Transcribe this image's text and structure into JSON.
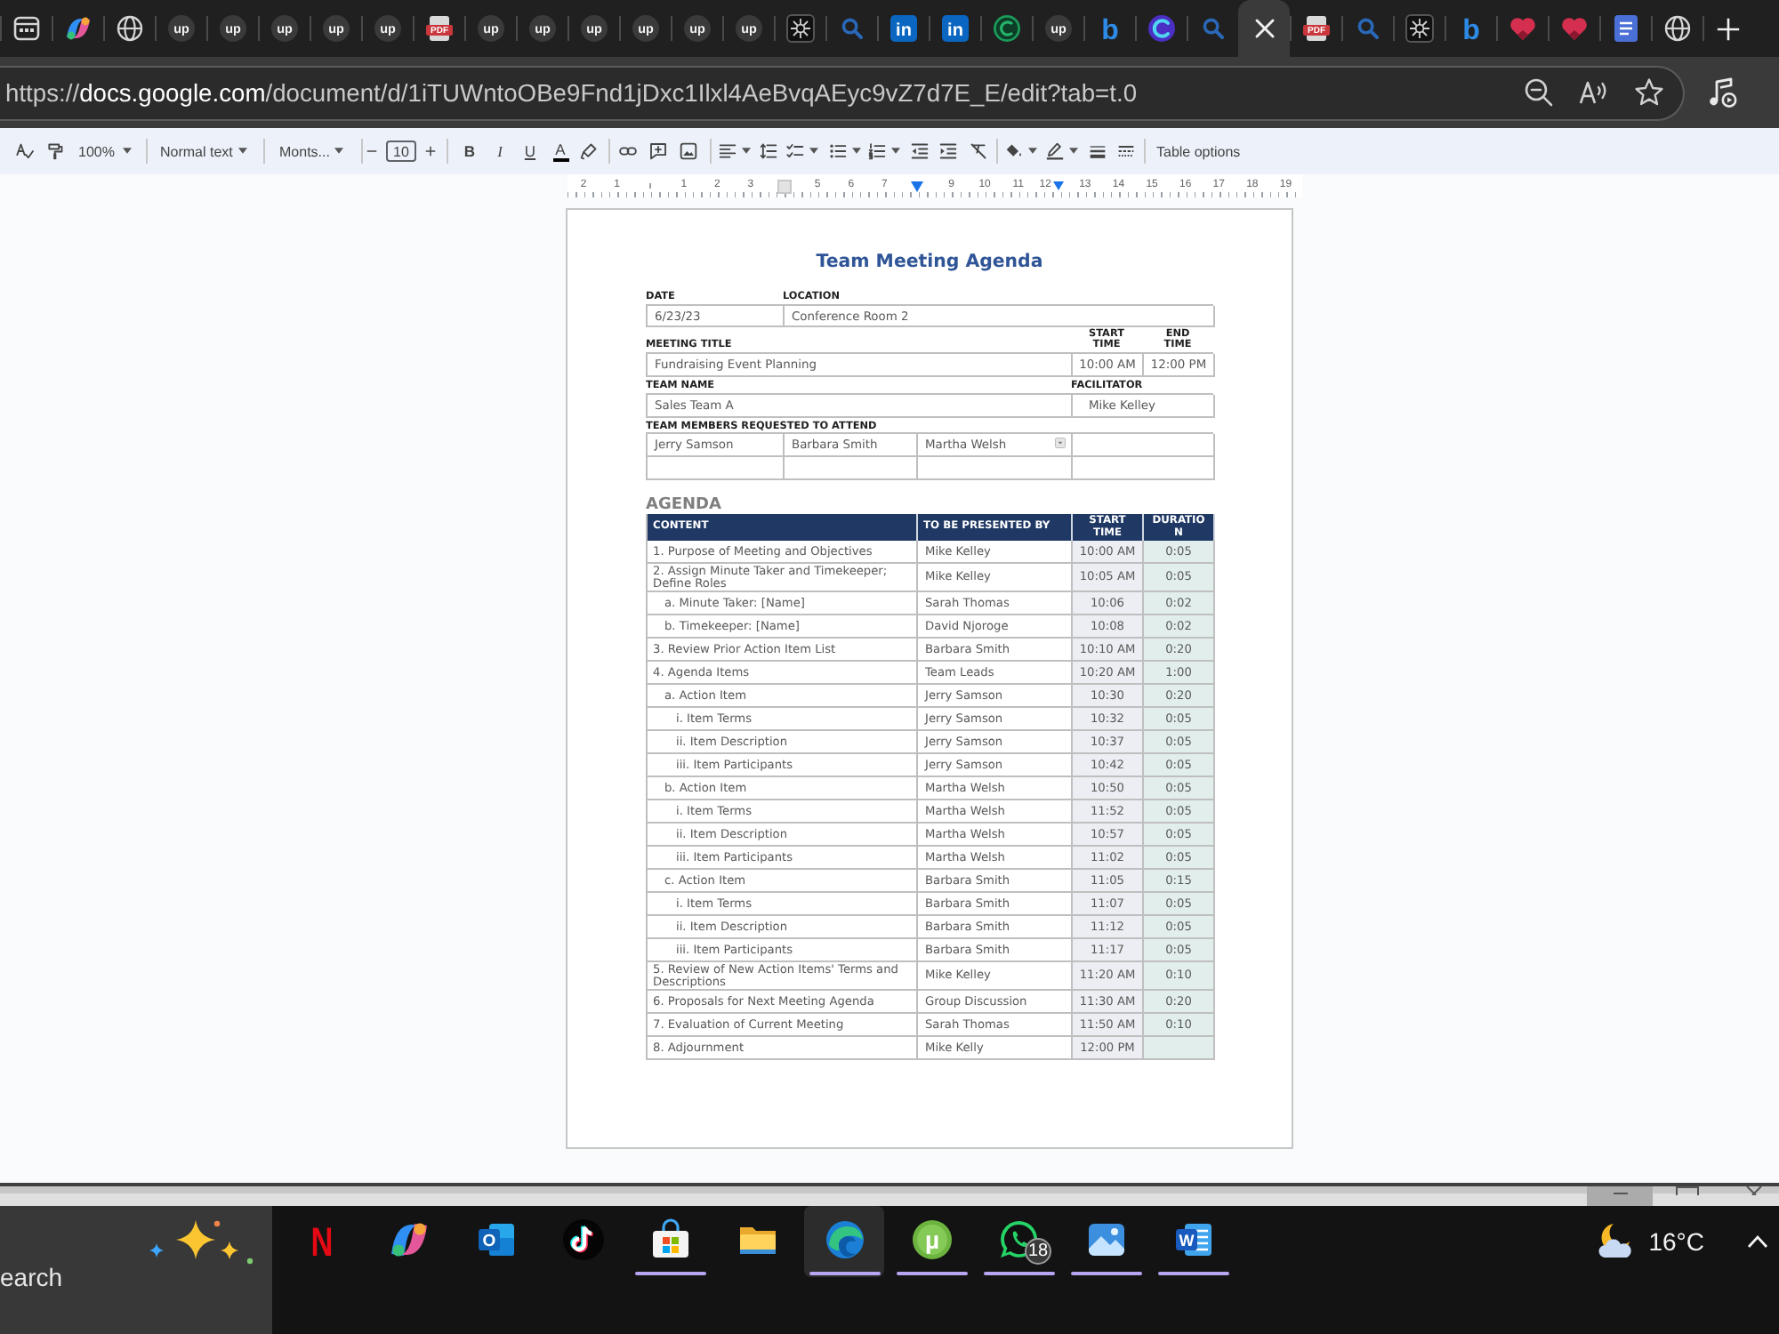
{
  "tabs": [
    {
      "kind": "window",
      "selected": false
    },
    {
      "kind": "swirl",
      "selected": false
    },
    {
      "kind": "globe",
      "selected": false
    },
    {
      "kind": "badge",
      "glyph": "up",
      "selected": false
    },
    {
      "kind": "badge",
      "glyph": "up",
      "selected": false
    },
    {
      "kind": "badge",
      "glyph": "up",
      "selected": false
    },
    {
      "kind": "badge",
      "glyph": "up",
      "selected": false
    },
    {
      "kind": "badge",
      "glyph": "up",
      "selected": false
    },
    {
      "kind": "file",
      "glyph": "PDF",
      "selected": false
    },
    {
      "kind": "badge",
      "glyph": "up",
      "selected": false
    },
    {
      "kind": "badge",
      "glyph": "up",
      "selected": false
    },
    {
      "kind": "badge",
      "glyph": "up",
      "selected": false
    },
    {
      "kind": "badge",
      "glyph": "up",
      "selected": false
    },
    {
      "kind": "badge",
      "glyph": "up",
      "selected": false
    },
    {
      "kind": "badge",
      "glyph": "up",
      "selected": false
    },
    {
      "kind": "spiky",
      "selected": false
    },
    {
      "kind": "search",
      "selected": false
    },
    {
      "kind": "tile",
      "glyph": "in",
      "selected": false
    },
    {
      "kind": "tile",
      "glyph": "in",
      "selected": false
    },
    {
      "kind": "ring",
      "selected": false
    },
    {
      "kind": "badge",
      "glyph": "up",
      "selected": false
    },
    {
      "kind": "letter",
      "glyph": "b",
      "selected": false
    },
    {
      "kind": "orb",
      "selected": false
    },
    {
      "kind": "search",
      "selected": false
    },
    {
      "selected": true
    },
    {
      "kind": "file",
      "glyph": "PDF",
      "selected": false
    },
    {
      "kind": "search",
      "selected": false
    },
    {
      "kind": "spiky",
      "selected": false
    },
    {
      "kind": "letter",
      "glyph": "b",
      "selected": false
    },
    {
      "kind": "heart",
      "selected": false
    },
    {
      "kind": "heart",
      "selected": false
    },
    {
      "kind": "doc",
      "selected": false
    },
    {
      "kind": "globe",
      "selected": false
    }
  ],
  "address_bar": {
    "url": "https://**docs.google.com**/document/d/1iTUWntoOBe9Fnd1jDxc1Ilxl4AeBvqAEyc9vZ7d7E_E/edit?tab=t.0"
  },
  "toolbar": {
    "zoom": "100%",
    "style": "Normal text",
    "font": "Monts...",
    "font_size": "10",
    "format_buttons": [
      {
        "kind": "bold",
        "label": "B"
      },
      {
        "kind": "italic",
        "label": "I"
      },
      {
        "kind": "underline",
        "label": "U"
      }
    ],
    "text_color": "A",
    "table_options": "Table options"
  },
  "ruler": [
    {
      "kind": "number",
      "text": "2",
      "marker": false
    },
    {
      "kind": "number",
      "text": "1",
      "marker": false
    },
    {
      "kind": "tick"
    },
    {
      "kind": "number",
      "text": "1",
      "marker": false
    },
    {
      "kind": "number",
      "text": "2",
      "marker": false
    },
    {
      "kind": "number",
      "text": "3",
      "marker": false
    },
    {
      "kind": "square"
    },
    {
      "kind": "number",
      "text": "5",
      "marker": false
    },
    {
      "kind": "number",
      "text": "6",
      "marker": false
    },
    {
      "kind": "number",
      "text": "7",
      "marker": false
    },
    {
      "kind": "indent"
    },
    {
      "kind": "number",
      "text": "9",
      "marker": false
    },
    {
      "kind": "number",
      "text": "10",
      "marker": false
    },
    {
      "kind": "number",
      "text": "11",
      "marker": false
    },
    {
      "kind": "number",
      "text": "12",
      "marker": true
    },
    {
      "kind": "number",
      "text": "13",
      "marker": false
    },
    {
      "kind": "number",
      "text": "14",
      "marker": false
    },
    {
      "kind": "number",
      "text": "15",
      "marker": false
    },
    {
      "kind": "number",
      "text": "16",
      "marker": false
    },
    {
      "kind": "number",
      "text": "17",
      "marker": false
    },
    {
      "kind": "number",
      "text": "18",
      "marker": false
    },
    {
      "kind": "number",
      "text": "19",
      "marker": false
    }
  ],
  "document": {
    "title": "Team Meeting Agenda",
    "form": {
      "date": {
        "label": "DATE",
        "value": "6/23/23"
      },
      "location": {
        "label": "LOCATION",
        "value": "Conference Room 2"
      },
      "meeting_title": {
        "label": "MEETING TITLE",
        "value": "Fundraising Event Planning"
      },
      "start_time": {
        "label": "START TIME",
        "value": "10:00 AM"
      },
      "end_time": {
        "label": "END TIME",
        "value": "12:00 PM"
      },
      "team_name": {
        "label": "TEAM NAME",
        "value": "Sales Team A"
      },
      "facilitator": {
        "label": "FACILITATOR",
        "value": "Mike Kelley"
      },
      "team_members": {
        "label": "TEAM MEMBERS REQUESTED TO ATTEND",
        "members": [
          {
            "name": "Jerry Samson",
            "menu": false
          },
          {
            "name": "Barbara Smith",
            "menu": false
          },
          {
            "name": "Martha Welsh",
            "menu": true
          }
        ]
      }
    },
    "agenda": {
      "heading": "AGENDA",
      "columns": [
        {
          "label": "CONTENT"
        },
        {
          "label": "TO BE PRESENTED BY"
        },
        {
          "label": "START TIME"
        },
        {
          "label": "DURATION"
        }
      ],
      "items": [
        {
          "content": "1. Purpose of Meeting and Objectives",
          "presenter": "Mike Kelley",
          "start": "10:00 AM",
          "duration": "0:05"
        },
        {
          "content": "2. Assign Minute Taker and Timekeeper; Define Roles",
          "presenter": "Mike Kelley",
          "start": "10:05 AM",
          "duration": "0:05",
          "children": [
            {
              "content": "a. Minute Taker: [Name]",
              "presenter": "Sarah Thomas",
              "start": "10:06",
              "duration": "0:02"
            },
            {
              "content": "b. Timekeeper: [Name]",
              "presenter": "David Njoroge",
              "start": "10:08",
              "duration": "0:02"
            }
          ]
        },
        {
          "content": "3. Review Prior Action Item List",
          "presenter": "Barbara Smith",
          "start": "10:10 AM",
          "duration": "0:20"
        },
        {
          "content": "4. Agenda Items",
          "presenter": "Team Leads",
          "start": "10:20 AM",
          "duration": "1:00",
          "children": [
            {
              "content": "a. Action Item",
              "presenter": "Jerry Samson",
              "start": "10:30",
              "duration": "0:20",
              "children": [
                {
                  "content": "i. Item Terms",
                  "presenter": "Jerry Samson",
                  "start": "10:32",
                  "duration": "0:05"
                },
                {
                  "content": "ii. Item Description",
                  "presenter": "Jerry Samson",
                  "start": "10:37",
                  "duration": "0:05"
                },
                {
                  "content": "iii. Item Participants",
                  "presenter": "Jerry Samson",
                  "start": "10:42",
                  "duration": "0:05"
                }
              ]
            },
            {
              "content": "b. Action Item",
              "presenter": "Martha Welsh",
              "start": "10:50",
              "duration": "0:05",
              "children": [
                {
                  "content": "i. Item Terms",
                  "presenter": "Martha Welsh",
                  "start": "11:52",
                  "duration": "0:05"
                },
                {
                  "content": "ii. Item Description",
                  "presenter": "Martha Welsh",
                  "start": "10:57",
                  "duration": "0:05"
                },
                {
                  "content": "iii. Item Participants",
                  "presenter": "Martha Welsh",
                  "start": "11:02",
                  "duration": "0:05"
                }
              ]
            },
            {
              "content": "c. Action Item",
              "presenter": "Barbara Smith",
              "start": "11:05",
              "duration": "0:15",
              "children": [
                {
                  "content": "i. Item Terms",
                  "presenter": "Barbara Smith",
                  "start": "11:07",
                  "duration": "0:05"
                },
                {
                  "content": "ii. Item Description",
                  "presenter": "Barbara Smith",
                  "start": "11:12",
                  "duration": "0:05"
                },
                {
                  "content": "iii. Item Participants",
                  "presenter": "Barbara Smith",
                  "start": "11:17",
                  "duration": "0:05"
                }
              ]
            }
          ]
        },
        {
          "content": "5. Review of New Action Items' Terms and Descriptions",
          "presenter": "Mike Kelley",
          "start": "11:20 AM",
          "duration": "0:10"
        },
        {
          "content": "6. Proposals for Next Meeting Agenda",
          "presenter": "Group Discussion",
          "start": "11:30 AM",
          "duration": "0:20"
        },
        {
          "content": "7. Evaluation of Current Meeting",
          "presenter": "Sarah Thomas",
          "start": "11:50 AM",
          "duration": "0:10"
        },
        {
          "content": "8. Adjournment",
          "presenter": "Mike Kelly",
          "start": "12:00 PM"
        }
      ]
    }
  },
  "taskbar": {
    "search": {
      "placeholder": "earch"
    },
    "apps": [
      {
        "kind": "letter",
        "glyph": "N",
        "running": false,
        "selected": false
      },
      {
        "kind": "swirl",
        "running": false,
        "selected": false
      },
      {
        "kind": "mail",
        "glyph": "O",
        "running": false,
        "selected": false
      },
      {
        "kind": "note",
        "running": false,
        "selected": false
      },
      {
        "kind": "bag",
        "running": true,
        "selected": false
      },
      {
        "kind": "folder",
        "running": false,
        "selected": false
      },
      {
        "kind": "wave",
        "running": true,
        "selected": true
      },
      {
        "kind": "torrent",
        "glyph": "µ",
        "running": true,
        "selected": false
      },
      {
        "kind": "chat",
        "badge": "18",
        "running": true,
        "selected": false
      },
      {
        "kind": "photo",
        "running": true,
        "selected": false
      },
      {
        "kind": "doc",
        "glyph": "W",
        "running": true,
        "selected": false
      }
    ],
    "weather": {
      "temperature": "16°C"
    }
  }
}
